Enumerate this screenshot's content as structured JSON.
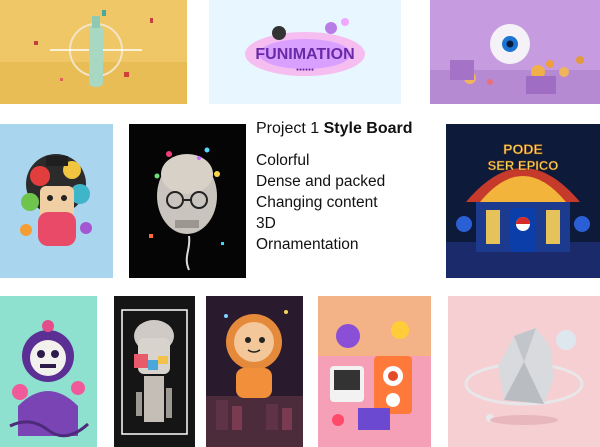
{
  "board": {
    "title_prefix": "Project 1 ",
    "title_bold": "Style Board",
    "items": [
      "Colorful",
      "Dense and packed",
      "Changing content",
      "3D",
      "Ornamentation"
    ]
  },
  "tiles": {
    "bottle": {
      "bg": "#efc766"
    },
    "funimation": {
      "bg": "#e8f7ff",
      "text": "FUNIMATION"
    },
    "eyeball": {
      "bg": "#c79be0"
    },
    "character": {
      "bg": "#a9d5ef"
    },
    "skull_head": {
      "bg": "#050505"
    },
    "pepsi": {
      "bg": "#0e1a3a",
      "text_line1": "PODE",
      "text_line2": "SER EPICO"
    },
    "monster": {
      "bg": "#8ee0cf"
    },
    "statue": {
      "bg": "#151515"
    },
    "astronaut": {
      "bg": "#2a1a2e"
    },
    "speakers": {
      "bg": "#f6a0b8"
    },
    "rock": {
      "bg": "#f6cfd3"
    }
  }
}
